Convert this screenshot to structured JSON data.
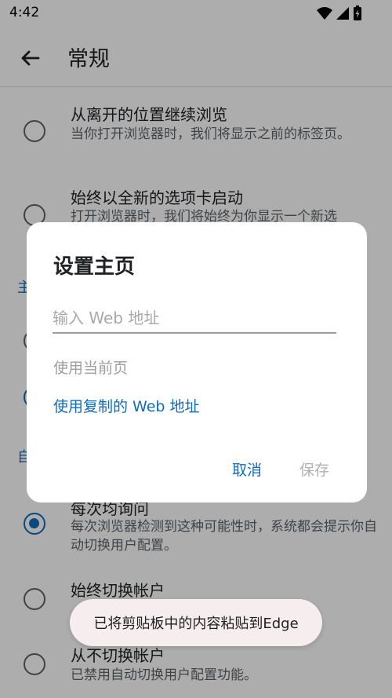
{
  "status_bar": {
    "time": "4:42"
  },
  "app_bar": {
    "title": "常规"
  },
  "options": {
    "resume": {
      "title": "从离开的位置继续浏览",
      "desc": "当你打开浏览器时，我们将显示之前的标签页。"
    },
    "new_tab": {
      "title": "始终以全新的选项卡启动",
      "desc": "打开浏览器时，我们将始终为你显示一个新选"
    },
    "ask": {
      "title": "每次均询问",
      "desc": "每次浏览器检测到这种可能性时，系统都会提示你自动切换用户配置。"
    },
    "always_switch": {
      "title": "始终切换帐户"
    },
    "never_switch": {
      "title": "从不切换帐户",
      "desc": "已禁用自动切换用户配置功能。"
    }
  },
  "dialog": {
    "title": "设置主页",
    "input_placeholder": "输入 Web 地址",
    "input_value": "",
    "use_current": "使用当前页",
    "use_copied": "使用复制的 Web 地址",
    "cancel": "取消",
    "save": "保存"
  },
  "toast": {
    "text": "已将剪贴板中的内容粘贴到Edge"
  },
  "colors": {
    "accent": "#0f6cbd",
    "scrim": "rgba(0,0,0,0.32)"
  }
}
